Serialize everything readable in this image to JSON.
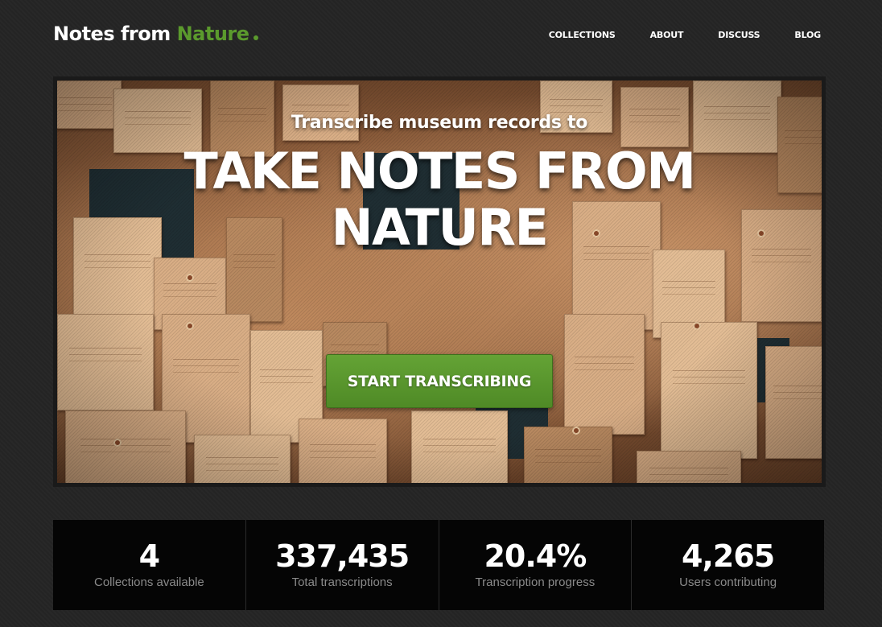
{
  "header": {
    "logo_part1": "Notes from ",
    "logo_part2": "Nature",
    "nav": [
      "COLLECTIONS",
      "ABOUT",
      "DISCUSS",
      "BLOG"
    ]
  },
  "hero": {
    "subtitle": "Transcribe museum records to",
    "title": "TAKE NOTES FROM NATURE",
    "cta_label": "START TRANSCRIBING"
  },
  "stats": [
    {
      "value": "4",
      "label": "Collections available"
    },
    {
      "value": "337,435",
      "label": "Total transcriptions"
    },
    {
      "value": "20.4%",
      "label": "Transcription progress"
    },
    {
      "value": "4,265",
      "label": "Users contributing"
    }
  ],
  "colors": {
    "accent": "#5b9a2d",
    "background": "#252525",
    "stats_background": "#050505"
  }
}
